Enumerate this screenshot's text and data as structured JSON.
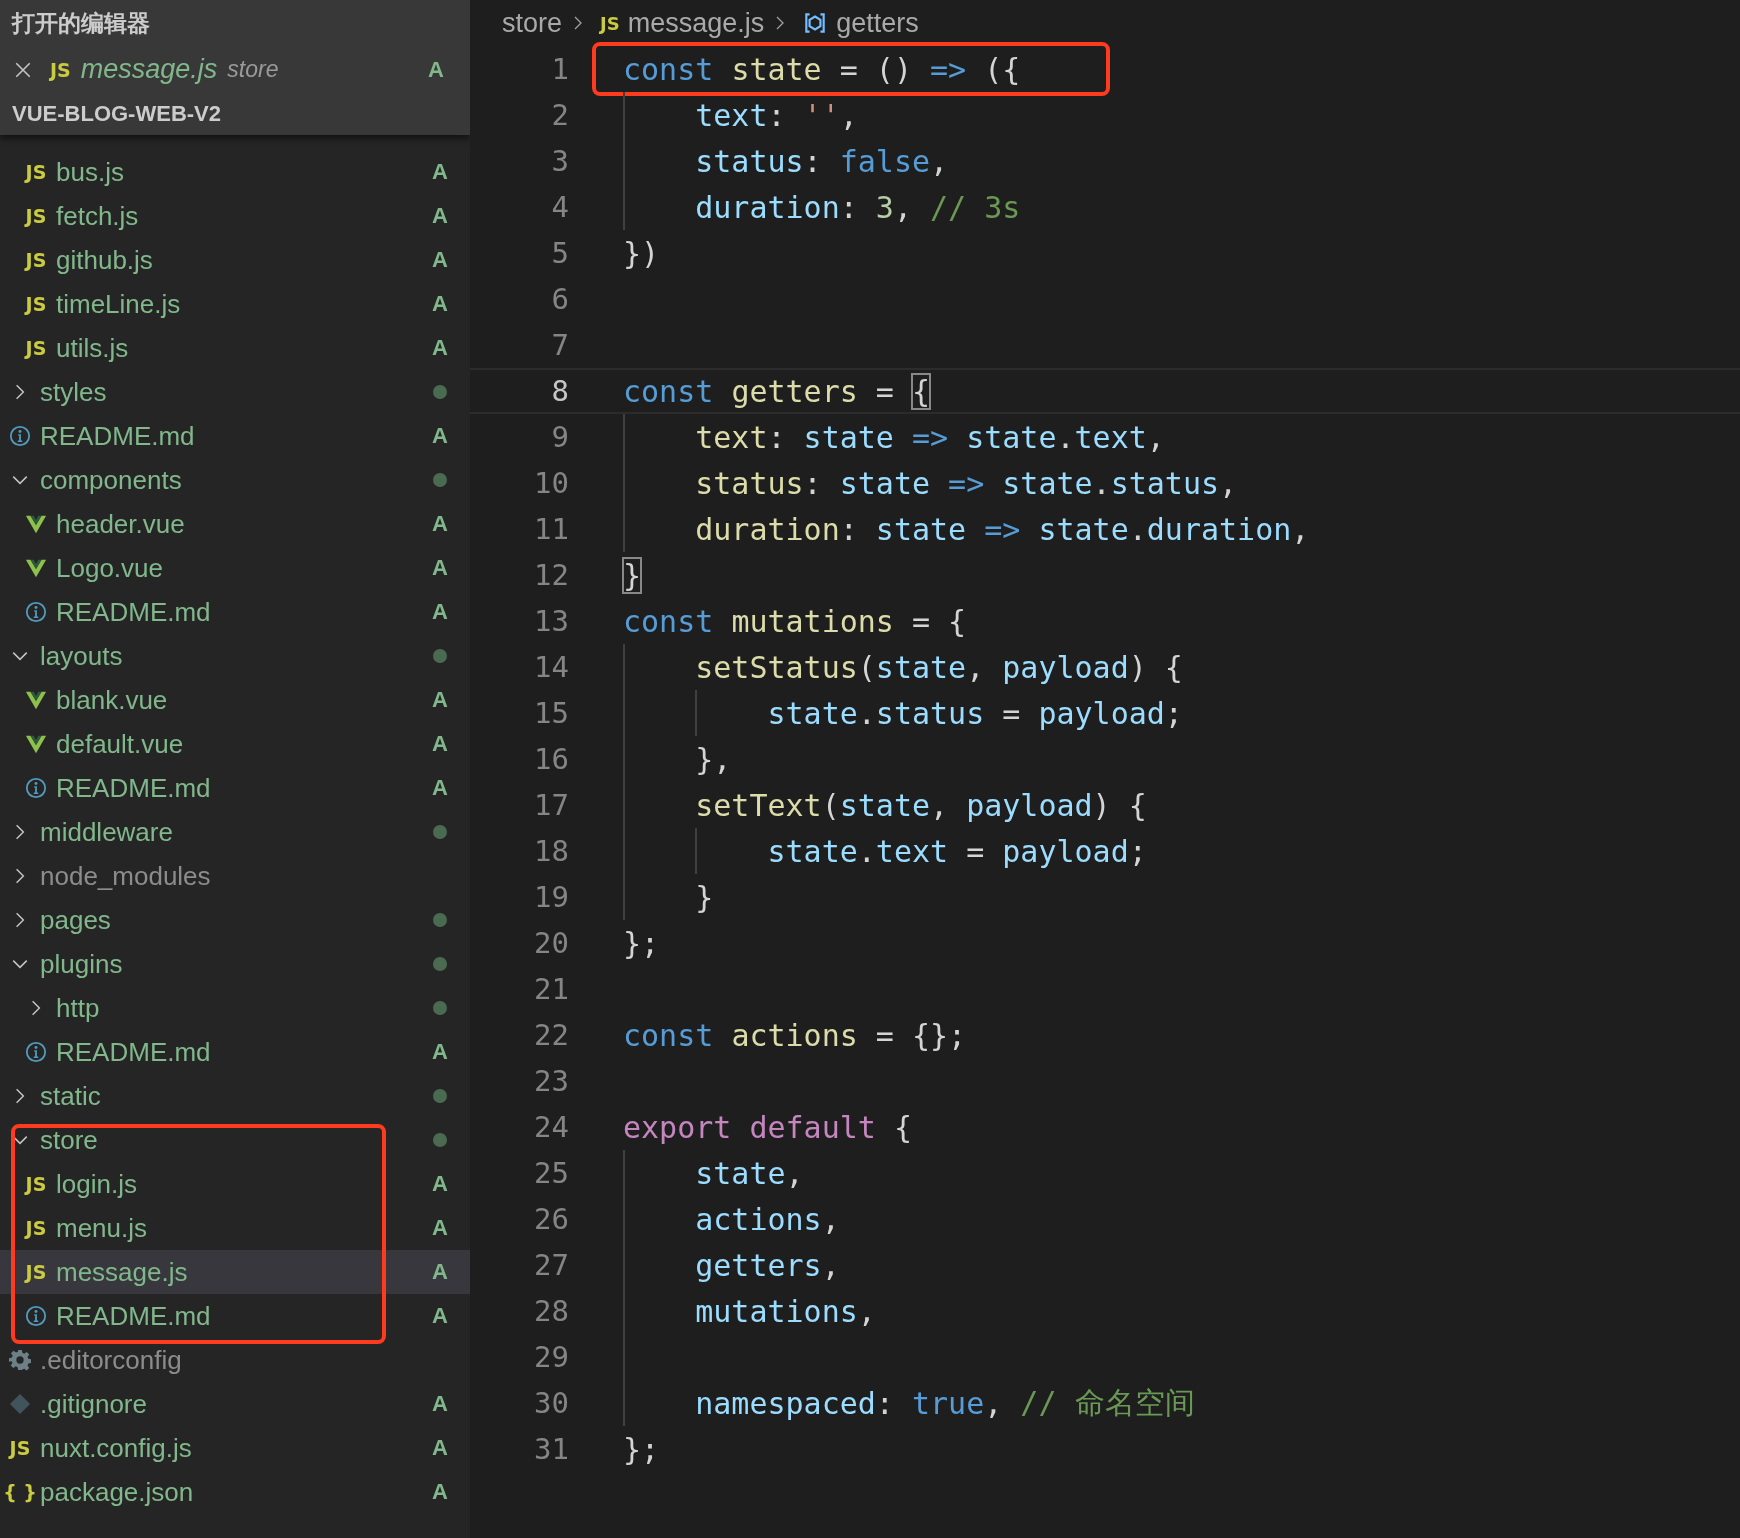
{
  "sidebar": {
    "open_editors_title": "打开的编辑器",
    "open_editors": [
      {
        "kind": "js",
        "icon_glyph": "JS",
        "label": "message.js",
        "folder": "store",
        "status": "A",
        "selected": false
      }
    ],
    "project_title": "VUE-BLOG-WEB-V2",
    "tree": [
      {
        "children": [
          {
            "kind": "js",
            "icon_glyph": "JS",
            "label": "bus.js",
            "status": "A"
          },
          {
            "kind": "js",
            "icon_glyph": "JS",
            "label": "fetch.js",
            "status": "A"
          },
          {
            "kind": "js",
            "icon_glyph": "JS",
            "label": "github.js",
            "status": "A"
          },
          {
            "kind": "js",
            "icon_glyph": "JS",
            "label": "timeLine.js",
            "status": "A"
          },
          {
            "kind": "js",
            "icon_glyph": "JS",
            "label": "utils.js",
            "status": "A"
          }
        ]
      },
      {
        "kind": "folder",
        "label": "styles",
        "expanded": false,
        "modified": true
      },
      {
        "kind": "readme",
        "label": "README.md",
        "status": "A"
      },
      {
        "kind": "folder",
        "label": "components",
        "expanded": true,
        "modified": true,
        "children": [
          {
            "kind": "vue",
            "label": "header.vue",
            "status": "A"
          },
          {
            "kind": "vue",
            "label": "Logo.vue",
            "status": "A"
          },
          {
            "kind": "readme",
            "label": "README.md",
            "status": "A"
          }
        ]
      },
      {
        "kind": "folder",
        "label": "layouts",
        "expanded": true,
        "modified": true,
        "children": [
          {
            "kind": "vue",
            "label": "blank.vue",
            "status": "A"
          },
          {
            "kind": "vue",
            "label": "default.vue",
            "status": "A"
          },
          {
            "kind": "readme",
            "label": "README.md",
            "status": "A"
          }
        ]
      },
      {
        "kind": "folder",
        "label": "middleware",
        "expanded": false,
        "modified": true
      },
      {
        "kind": "folder",
        "label": "node_modules",
        "expanded": false,
        "ignored": true
      },
      {
        "kind": "folder",
        "label": "pages",
        "expanded": false,
        "modified": true
      },
      {
        "kind": "folder",
        "label": "plugins",
        "expanded": true,
        "modified": true,
        "children": [
          {
            "kind": "folder",
            "label": "http",
            "expanded": false,
            "modified": true
          },
          {
            "kind": "readme",
            "label": "README.md",
            "status": "A"
          }
        ]
      },
      {
        "kind": "folder",
        "label": "static",
        "expanded": false,
        "modified": true
      },
      {
        "kind": "folder",
        "label": "store",
        "expanded": true,
        "modified": true,
        "boxed": true,
        "children": [
          {
            "kind": "js",
            "icon_glyph": "JS",
            "label": "login.js",
            "status": "A",
            "selected": false
          },
          {
            "kind": "js",
            "icon_glyph": "JS",
            "label": "menu.js",
            "status": "A",
            "selected": false
          },
          {
            "kind": "js",
            "icon_glyph": "JS",
            "label": "message.js",
            "status": "A",
            "selected": true
          },
          {
            "kind": "readme",
            "label": "README.md",
            "status": "A",
            "selected": false
          }
        ]
      },
      {
        "kind": "config",
        "label": ".editorconfig",
        "ignored": true
      },
      {
        "kind": "git",
        "label": ".gitignore",
        "status": "A"
      },
      {
        "kind": "js",
        "icon_glyph": "JS",
        "label": "nuxt.config.js",
        "status": "A"
      },
      {
        "kind": "json",
        "icon_glyph": "{ }",
        "label": "package.json",
        "status": "A"
      }
    ]
  },
  "breadcrumb": [
    {
      "kind": "folder",
      "label": "store"
    },
    {
      "kind": "file",
      "icon_glyph": "JS",
      "label": "message.js"
    },
    {
      "kind": "symbol",
      "label": "getters"
    }
  ],
  "editor": {
    "lines": [
      {
        "number": "1",
        "boxed": true,
        "tokens": [
          {
            "text": "const ",
            "kind": "keyword"
          },
          {
            "text": "state",
            "kind": "fn"
          },
          {
            "text": " = () ",
            "kind": "punct"
          },
          {
            "text": "=>",
            "kind": "keyword"
          },
          {
            "text": " ({",
            "kind": "punct"
          }
        ]
      },
      {
        "number": "2",
        "tokens": [
          {
            "kind": "indent"
          },
          {
            "text": "text",
            "kind": "var"
          },
          {
            "text": ": ",
            "kind": "punct"
          },
          {
            "text": "''",
            "kind": "str"
          },
          {
            "text": ",",
            "kind": "punct"
          }
        ]
      },
      {
        "number": "3",
        "tokens": [
          {
            "kind": "indent"
          },
          {
            "text": "status",
            "kind": "var"
          },
          {
            "text": ": ",
            "kind": "punct"
          },
          {
            "text": "false",
            "kind": "keyword"
          },
          {
            "text": ",",
            "kind": "punct"
          }
        ]
      },
      {
        "number": "4",
        "tokens": [
          {
            "kind": "indent"
          },
          {
            "text": "duration",
            "kind": "var"
          },
          {
            "text": ": ",
            "kind": "punct"
          },
          {
            "text": "3",
            "kind": "num"
          },
          {
            "text": ", ",
            "kind": "punct"
          },
          {
            "text": "// 3s",
            "kind": "comment"
          }
        ]
      },
      {
        "number": "5",
        "tokens": [
          {
            "text": "})",
            "kind": "punct"
          }
        ]
      },
      {
        "number": "6"
      },
      {
        "number": "7"
      },
      {
        "number": "8",
        "current": true,
        "tokens": [
          {
            "text": "const ",
            "kind": "keyword"
          },
          {
            "text": "getters",
            "kind": "fn"
          },
          {
            "text": " = ",
            "kind": "punct"
          },
          {
            "text": "{",
            "kind": "punct",
            "matched": true
          }
        ]
      },
      {
        "number": "9",
        "tokens": [
          {
            "kind": "indent"
          },
          {
            "text": "text",
            "kind": "fn"
          },
          {
            "text": ": ",
            "kind": "punct"
          },
          {
            "text": "state",
            "kind": "var"
          },
          {
            "text": " => ",
            "kind": "keyword"
          },
          {
            "text": "state",
            "kind": "var"
          },
          {
            "text": ".",
            "kind": "punct"
          },
          {
            "text": "text",
            "kind": "var"
          },
          {
            "text": ",",
            "kind": "punct"
          }
        ]
      },
      {
        "number": "10",
        "tokens": [
          {
            "kind": "indent"
          },
          {
            "text": "status",
            "kind": "fn"
          },
          {
            "text": ": ",
            "kind": "punct"
          },
          {
            "text": "state",
            "kind": "var"
          },
          {
            "text": " => ",
            "kind": "keyword"
          },
          {
            "text": "state",
            "kind": "var"
          },
          {
            "text": ".",
            "kind": "punct"
          },
          {
            "text": "status",
            "kind": "var"
          },
          {
            "text": ",",
            "kind": "punct"
          }
        ]
      },
      {
        "number": "11",
        "tokens": [
          {
            "kind": "indent"
          },
          {
            "text": "duration",
            "kind": "fn"
          },
          {
            "text": ": ",
            "kind": "punct"
          },
          {
            "text": "state",
            "kind": "var"
          },
          {
            "text": " => ",
            "kind": "keyword"
          },
          {
            "text": "state",
            "kind": "var"
          },
          {
            "text": ".",
            "kind": "punct"
          },
          {
            "text": "duration",
            "kind": "var"
          },
          {
            "text": ",",
            "kind": "punct"
          }
        ]
      },
      {
        "number": "12",
        "tokens": [
          {
            "text": "}",
            "kind": "punct",
            "matched": true
          }
        ]
      },
      {
        "number": "13",
        "tokens": [
          {
            "text": "const ",
            "kind": "keyword"
          },
          {
            "text": "mutations",
            "kind": "fn"
          },
          {
            "text": " = {",
            "kind": "punct"
          }
        ]
      },
      {
        "number": "14",
        "tokens": [
          {
            "kind": "indent"
          },
          {
            "text": "setStatus",
            "kind": "fn"
          },
          {
            "text": "(",
            "kind": "punct"
          },
          {
            "text": "state",
            "kind": "var"
          },
          {
            "text": ", ",
            "kind": "punct"
          },
          {
            "text": "payload",
            "kind": "var"
          },
          {
            "text": ") {",
            "kind": "punct"
          }
        ]
      },
      {
        "number": "15",
        "tokens": [
          {
            "kind": "indent"
          },
          {
            "kind": "indent"
          },
          {
            "text": "state",
            "kind": "var"
          },
          {
            "text": ".",
            "kind": "punct"
          },
          {
            "text": "status",
            "kind": "var"
          },
          {
            "text": " = ",
            "kind": "punct"
          },
          {
            "text": "payload",
            "kind": "var"
          },
          {
            "text": ";",
            "kind": "punct"
          }
        ]
      },
      {
        "number": "16",
        "tokens": [
          {
            "kind": "indent"
          },
          {
            "text": "},",
            "kind": "punct"
          }
        ]
      },
      {
        "number": "17",
        "tokens": [
          {
            "kind": "indent"
          },
          {
            "text": "setText",
            "kind": "fn"
          },
          {
            "text": "(",
            "kind": "punct"
          },
          {
            "text": "state",
            "kind": "var"
          },
          {
            "text": ", ",
            "kind": "punct"
          },
          {
            "text": "payload",
            "kind": "var"
          },
          {
            "text": ") {",
            "kind": "punct"
          }
        ]
      },
      {
        "number": "18",
        "tokens": [
          {
            "kind": "indent"
          },
          {
            "kind": "indent"
          },
          {
            "text": "state",
            "kind": "var"
          },
          {
            "text": ".",
            "kind": "punct"
          },
          {
            "text": "text",
            "kind": "var"
          },
          {
            "text": " = ",
            "kind": "punct"
          },
          {
            "text": "payload",
            "kind": "var"
          },
          {
            "text": ";",
            "kind": "punct"
          }
        ]
      },
      {
        "number": "19",
        "tokens": [
          {
            "kind": "indent"
          },
          {
            "text": "}",
            "kind": "punct"
          }
        ]
      },
      {
        "number": "20",
        "tokens": [
          {
            "text": "};",
            "kind": "punct"
          }
        ]
      },
      {
        "number": "21"
      },
      {
        "number": "22",
        "tokens": [
          {
            "text": "const ",
            "kind": "keyword"
          },
          {
            "text": "actions",
            "kind": "fn"
          },
          {
            "text": " = {};",
            "kind": "punct"
          }
        ]
      },
      {
        "number": "23"
      },
      {
        "number": "24",
        "tokens": [
          {
            "text": "export default",
            "kind": "control"
          },
          {
            "text": " {",
            "kind": "punct"
          }
        ]
      },
      {
        "number": "25",
        "tokens": [
          {
            "kind": "indent"
          },
          {
            "text": "state",
            "kind": "var"
          },
          {
            "text": ",",
            "kind": "punct"
          }
        ]
      },
      {
        "number": "26",
        "tokens": [
          {
            "kind": "indent"
          },
          {
            "text": "actions",
            "kind": "var"
          },
          {
            "text": ",",
            "kind": "punct"
          }
        ]
      },
      {
        "number": "27",
        "tokens": [
          {
            "kind": "indent"
          },
          {
            "text": "getters",
            "kind": "var"
          },
          {
            "text": ",",
            "kind": "punct"
          }
        ]
      },
      {
        "number": "28",
        "tokens": [
          {
            "kind": "indent"
          },
          {
            "text": "mutations",
            "kind": "var"
          },
          {
            "text": ",",
            "kind": "punct"
          }
        ]
      },
      {
        "number": "29",
        "tokens": [
          {
            "kind": "indent"
          }
        ]
      },
      {
        "number": "30",
        "tokens": [
          {
            "kind": "indent"
          },
          {
            "text": "namespaced",
            "kind": "var"
          },
          {
            "text": ": ",
            "kind": "punct"
          },
          {
            "text": "true",
            "kind": "keyword"
          },
          {
            "text": ", ",
            "kind": "punct"
          },
          {
            "text": "// 命名空间",
            "kind": "comment"
          }
        ]
      },
      {
        "number": "31",
        "tokens": [
          {
            "text": "};",
            "kind": "punct"
          }
        ]
      }
    ]
  }
}
